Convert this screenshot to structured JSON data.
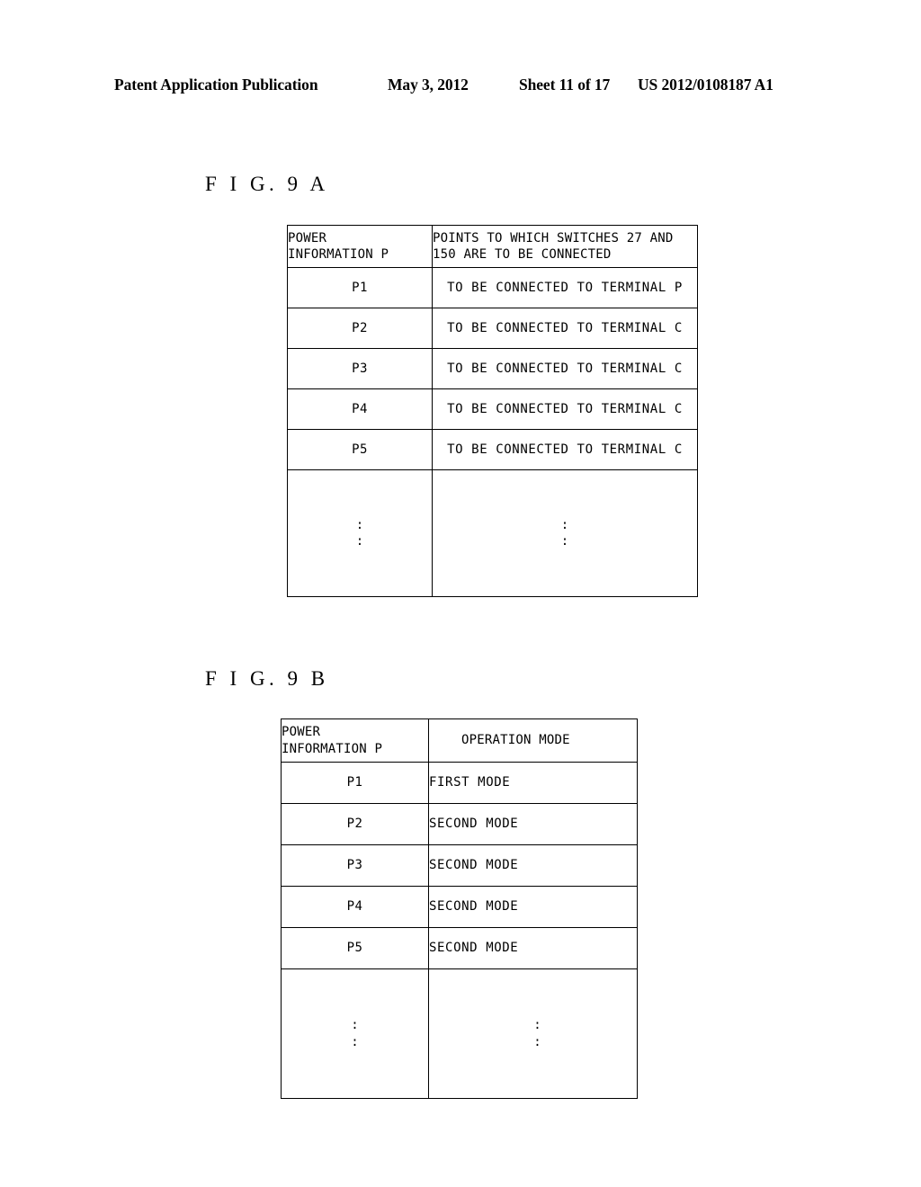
{
  "header": {
    "publication": "Patent Application Publication",
    "date": "May 3, 2012",
    "sheet": "Sheet 11 of 17",
    "document_number": "US 2012/0108187 A1"
  },
  "figures": [
    {
      "label": "F I G.  9 A",
      "table": {
        "columns": [
          {
            "lines": [
              "POWER",
              "INFORMATION P"
            ]
          },
          {
            "lines": [
              "POINTS TO WHICH SWITCHES 27 AND",
              "150 ARE TO BE CONNECTED"
            ]
          }
        ],
        "rows": [
          {
            "id": "P1",
            "value": "TO BE CONNECTED TO TERMINAL P"
          },
          {
            "id": "P2",
            "value": "TO BE CONNECTED TO TERMINAL C"
          },
          {
            "id": "P3",
            "value": "TO BE CONNECTED TO TERMINAL C"
          },
          {
            "id": "P4",
            "value": "TO BE CONNECTED TO TERMINAL C"
          },
          {
            "id": "P5",
            "value": "TO BE CONNECTED TO TERMINAL C"
          }
        ],
        "continuation": {
          "id": ":",
          "value": ":"
        }
      }
    },
    {
      "label": "F I G.  9 B",
      "table": {
        "columns": [
          {
            "lines": [
              "POWER",
              "INFORMATION P"
            ]
          },
          {
            "lines": [
              "OPERATION MODE"
            ]
          }
        ],
        "rows": [
          {
            "id": "P1",
            "value": "FIRST MODE"
          },
          {
            "id": "P2",
            "value": "SECOND MODE"
          },
          {
            "id": "P3",
            "value": "SECOND MODE"
          },
          {
            "id": "P4",
            "value": "SECOND MODE"
          },
          {
            "id": "P5",
            "value": "SECOND MODE"
          }
        ],
        "continuation": {
          "id": ":",
          "value": ":"
        }
      }
    }
  ]
}
